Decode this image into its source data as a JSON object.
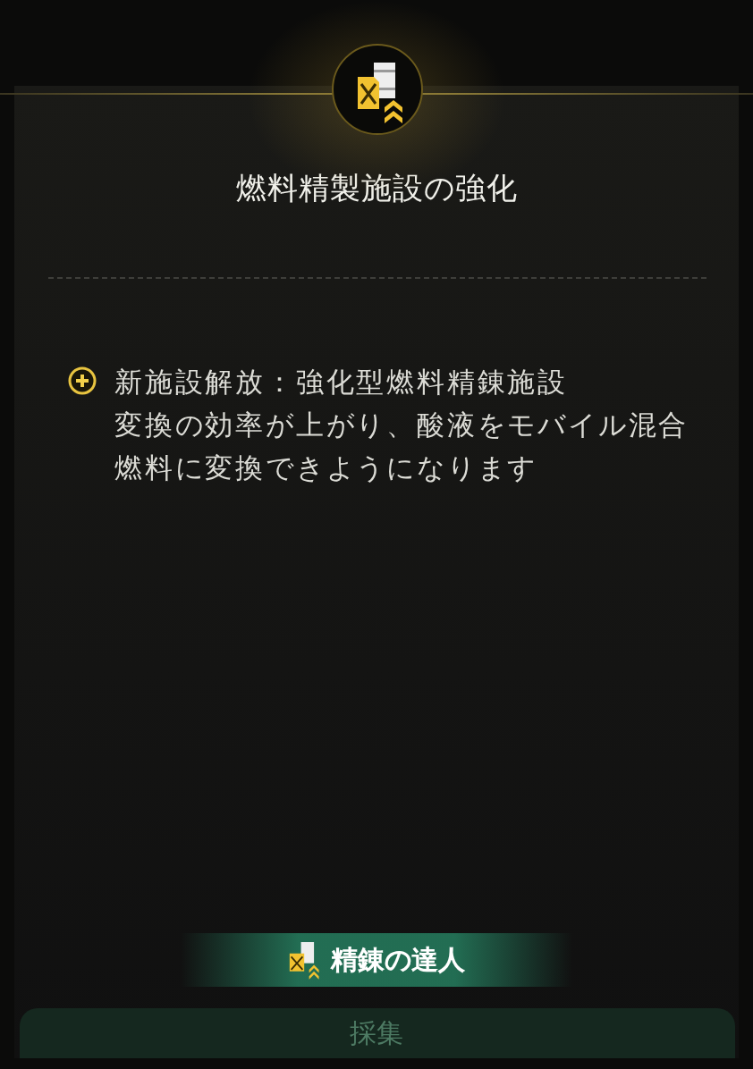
{
  "title": "燃料精製施設の強化",
  "effects": [
    {
      "kind": "unlock",
      "heading": "新施設解放：強化型燃料精錬施設",
      "body": "変換の効率が上がり、酸液をモバイル混合燃料に変換できようになります"
    }
  ],
  "badge": {
    "label": "精錬の達人"
  },
  "tab": {
    "label": "採集"
  }
}
